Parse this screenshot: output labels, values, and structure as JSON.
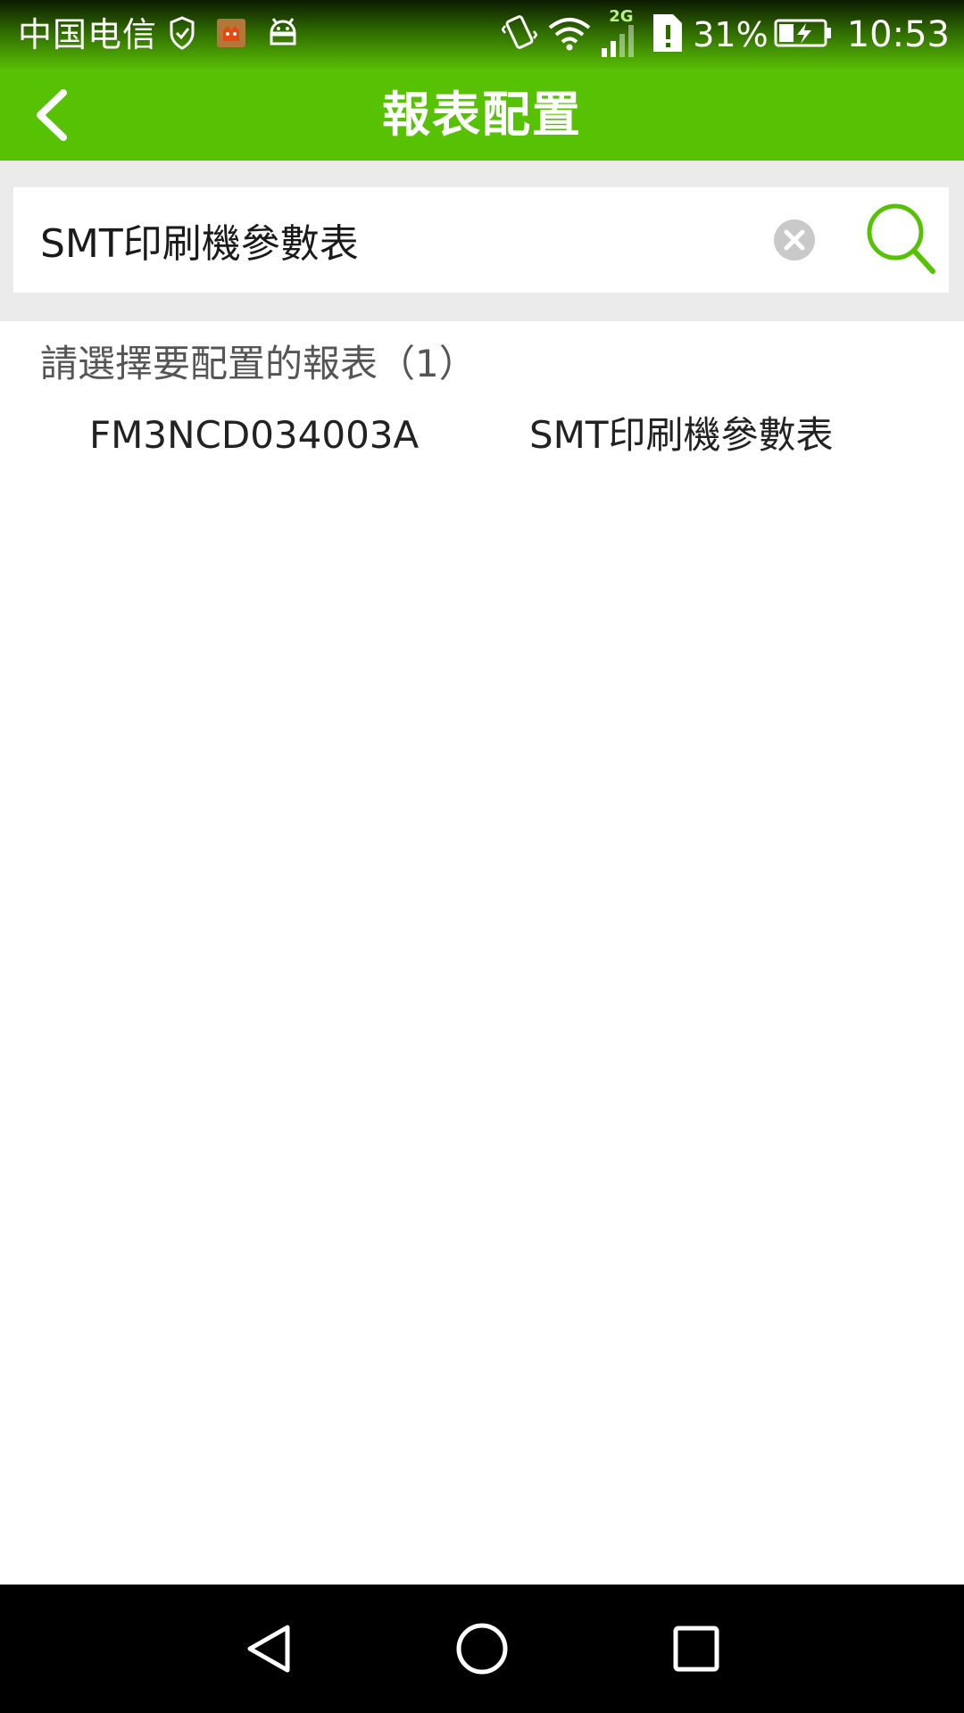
{
  "status_bar": {
    "carrier": "中国电信",
    "network_type": "2G",
    "battery_percent": "31%",
    "time": "10:53",
    "icons": [
      "shield-check-icon",
      "app-notification-icon",
      "android-icon",
      "vibrate-icon",
      "wifi-icon",
      "signal-icon",
      "sim-alert-icon",
      "battery-charging-icon"
    ]
  },
  "header": {
    "title": "報表配置",
    "back_icon": "chevron-left-icon"
  },
  "search": {
    "value": "SMT印刷機參數表",
    "clear_icon": "clear-icon",
    "search_icon": "search-icon"
  },
  "list": {
    "header": "請選擇要配置的報表（1）",
    "items": [
      {
        "code": "FM3NCD034003A",
        "name": "SMT印刷機參數表"
      }
    ]
  },
  "nav_bar": {
    "icons": [
      "nav-back-icon",
      "nav-home-icon",
      "nav-recents-icon"
    ]
  },
  "colors": {
    "primary": "#57c104",
    "search_background": "#ebebeb",
    "nav_background": "#000000"
  }
}
